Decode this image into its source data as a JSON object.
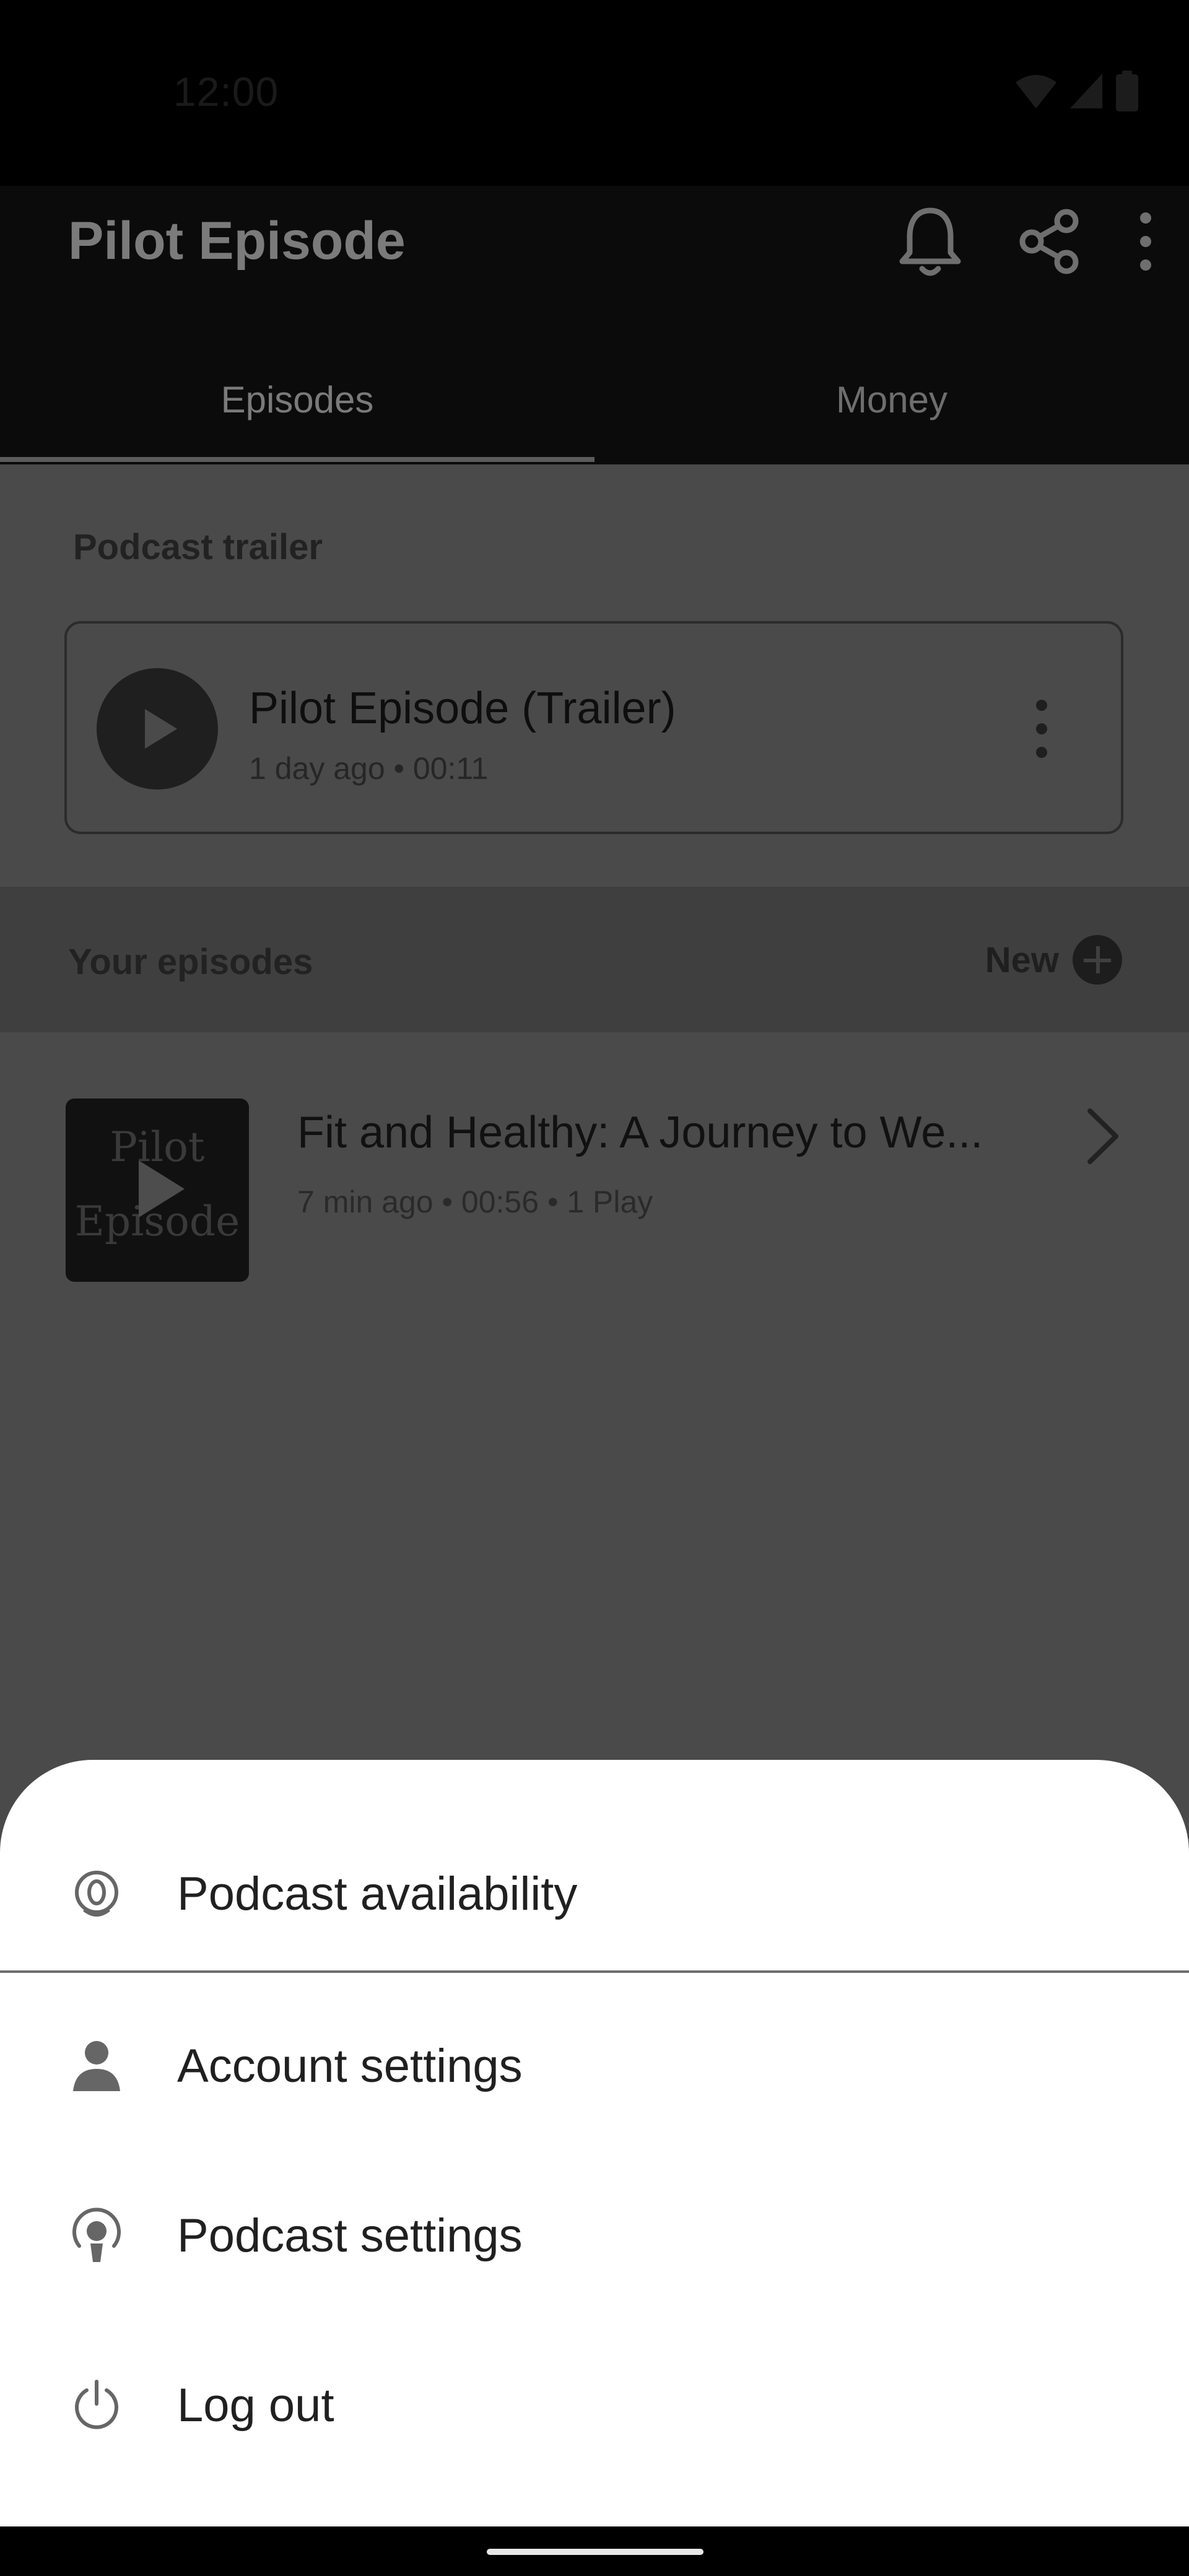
{
  "status_bar": {
    "time": "12:00"
  },
  "header": {
    "title": "Pilot Episode",
    "tabs": [
      {
        "label": "Episodes",
        "active": true
      },
      {
        "label": "Money",
        "active": false
      }
    ]
  },
  "trailer_section": {
    "heading": "Podcast trailer",
    "card": {
      "title": "Pilot Episode (Trailer)",
      "meta": "1 day ago • 00:11"
    }
  },
  "episodes_section": {
    "heading": "Your episodes",
    "new_label": "New"
  },
  "episodes": [
    {
      "thumb_text_top": "Pilot",
      "thumb_text_bottom": "Episode",
      "title": "Fit and Healthy: A Journey to We...",
      "time": "7 min ago",
      "duration": "00:56",
      "plays": "1 Play"
    }
  ],
  "sheet": {
    "items": [
      {
        "label": "Podcast availability",
        "icon": "availability-icon"
      },
      {
        "label": "Account settings",
        "icon": "person-icon"
      },
      {
        "label": "Podcast settings",
        "icon": "podcast-mic-icon"
      },
      {
        "label": "Log out",
        "icon": "power-icon"
      }
    ]
  }
}
